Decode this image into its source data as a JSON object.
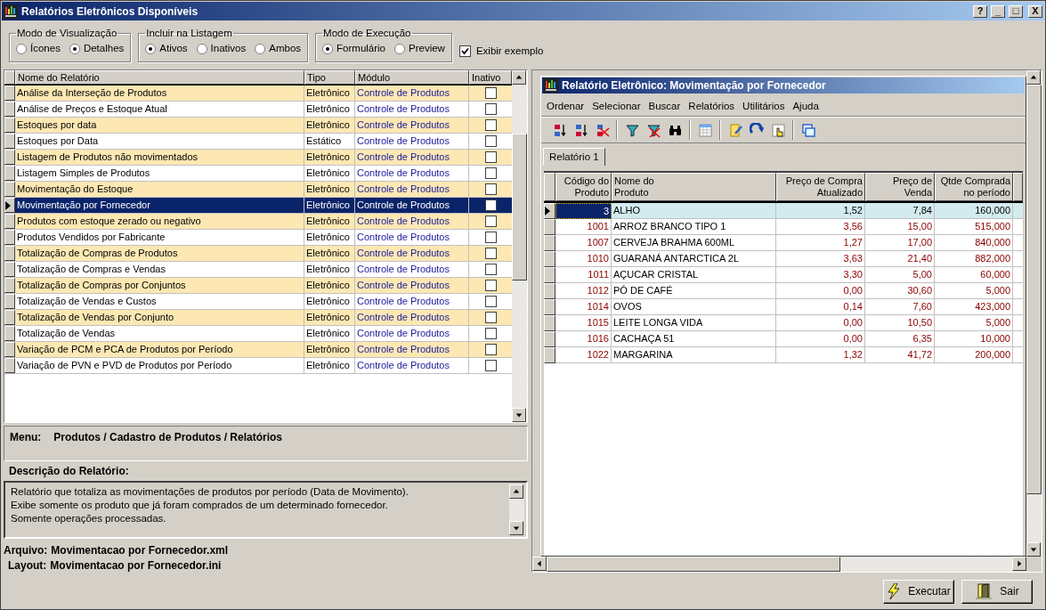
{
  "window": {
    "title": "Relatórios Eletrônicos Disponíveis",
    "title_buttons": [
      "?",
      "_",
      "□",
      "X"
    ]
  },
  "option_groups": [
    {
      "title": "Modo de Visualização",
      "options": [
        {
          "label": "Ícones",
          "selected": false
        },
        {
          "label": "Detalhes",
          "selected": true
        }
      ]
    },
    {
      "title": "Incluir na Listagem",
      "options": [
        {
          "label": "Ativos",
          "selected": true
        },
        {
          "label": "Inativos",
          "selected": false
        },
        {
          "label": "Ambos",
          "selected": false
        }
      ]
    },
    {
      "title": "Modo de Execução",
      "options": [
        {
          "label": "Formulário",
          "selected": true
        },
        {
          "label": "Preview",
          "selected": false
        }
      ]
    }
  ],
  "show_example": {
    "label": "Exibir exemplo",
    "checked": true
  },
  "reports_table": {
    "columns": [
      "Nome do Relatório",
      "Tipo",
      "Módulo",
      "Inativo"
    ],
    "rows": [
      {
        "name": "Análise da Interseção de Produtos",
        "type": "Eletrônico",
        "module": "Controle de Produtos",
        "inactive": false,
        "selected": false
      },
      {
        "name": "Análise de Preços e Estoque Atual",
        "type": "Eletrônico",
        "module": "Controle de Produtos",
        "inactive": false,
        "selected": false
      },
      {
        "name": "Estoques por data",
        "type": "Eletrônico",
        "module": "Controle de Produtos",
        "inactive": false,
        "selected": false
      },
      {
        "name": "Estoques por Data",
        "type": "Estático",
        "module": "Controle de Produtos",
        "inactive": false,
        "selected": false
      },
      {
        "name": "Listagem de Produtos não movimentados",
        "type": "Eletrônico",
        "module": "Controle de Produtos",
        "inactive": false,
        "selected": false
      },
      {
        "name": "Listagem Simples de Produtos",
        "type": "Eletrônico",
        "module": "Controle de Produtos",
        "inactive": false,
        "selected": false
      },
      {
        "name": "Movimentação do Estoque",
        "type": "Eletrônico",
        "module": "Controle de Produtos",
        "inactive": false,
        "selected": false
      },
      {
        "name": "Movimentação por Fornecedor",
        "type": "Eletrônico",
        "module": "Controle de Produtos",
        "inactive": false,
        "selected": true
      },
      {
        "name": "Produtos com estoque zerado ou negativo",
        "type": "Eletrônico",
        "module": "Controle de Produtos",
        "inactive": false,
        "selected": false
      },
      {
        "name": "Produtos Vendidos por Fabricante",
        "type": "Eletrônico",
        "module": "Controle de Produtos",
        "inactive": false,
        "selected": false
      },
      {
        "name": "Totalização de Compras de Produtos",
        "type": "Eletrônico",
        "module": "Controle de Produtos",
        "inactive": false,
        "selected": false
      },
      {
        "name": "Totalização de Compras e Vendas",
        "type": "Eletrônico",
        "module": "Controle de Produtos",
        "inactive": false,
        "selected": false
      },
      {
        "name": "Totalização de Compras por Conjuntos",
        "type": "Eletrônico",
        "module": "Controle de Produtos",
        "inactive": false,
        "selected": false
      },
      {
        "name": "Totalização de Vendas e Custos",
        "type": "Eletrônico",
        "module": "Controle de Produtos",
        "inactive": false,
        "selected": false
      },
      {
        "name": "Totalização de Vendas por Conjunto",
        "type": "Eletrônico",
        "module": "Controle de Produtos",
        "inactive": false,
        "selected": false
      },
      {
        "name": "Totalização de Vendas",
        "type": "Eletrônico",
        "module": "Controle de Produtos",
        "inactive": false,
        "selected": false
      },
      {
        "name": "Variação de PCM e PCA de Produtos por Período",
        "type": "Eletrônico",
        "module": "Controle de Produtos",
        "inactive": false,
        "selected": false
      },
      {
        "name": "Variação de PVN e PVD de Produtos por Período",
        "type": "Eletrônico",
        "module": "Controle de Produtos",
        "inactive": false,
        "selected": false
      }
    ]
  },
  "menu_path": {
    "label": "Menu:",
    "value": "Produtos / Cadastro de Produtos / Relatórios"
  },
  "description": {
    "label": "Descrição do Relatório:",
    "lines": [
      "Relatório que totaliza as movimentações de produtos por período (Data de Movimento).",
      "Exibe somente os produto que já foram comprados de um determinado fornecedor.",
      "Somente operações processadas."
    ]
  },
  "file_info": [
    {
      "label": "Arquivo:",
      "value": "Movimentacao por Fornecedor.xml"
    },
    {
      "label": "Layout:",
      "value": "Movimentacao por Fornecedor.ini"
    }
  ],
  "preview_window": {
    "title": "Relatório Eletrônico: Movimentação por Fornecedor",
    "menu": [
      "Ordenar",
      "Selecionar",
      "Buscar",
      "Relatórios",
      "Utilitários",
      "Ajuda"
    ],
    "toolbar": [
      {
        "kind": "sort-asc"
      },
      {
        "kind": "sort-desc"
      },
      {
        "kind": "sort-clear"
      },
      {
        "kind": "sep"
      },
      {
        "kind": "filter"
      },
      {
        "kind": "filter-clear"
      },
      {
        "kind": "find"
      },
      {
        "kind": "sep"
      },
      {
        "kind": "grid"
      },
      {
        "kind": "sep"
      },
      {
        "kind": "edit"
      },
      {
        "kind": "refresh"
      },
      {
        "kind": "hand"
      },
      {
        "kind": "sep"
      },
      {
        "kind": "windows"
      }
    ],
    "tabs": [
      {
        "label": "Relatório 1",
        "selected": true
      }
    ],
    "columns": [
      "Código do\nProduto",
      "Nome do\nProduto",
      "Preço de Compra\nAtualizado",
      "Preço de\nVenda",
      "Qtde Comprada\nno período"
    ],
    "rows": [
      {
        "code": "3",
        "name": "ALHO",
        "buy": "1,52",
        "sell": "7,84",
        "qty": "160,000",
        "selected": true
      },
      {
        "code": "1001",
        "name": "ARROZ BRANCO TIPO 1",
        "buy": "3,56",
        "sell": "15,00",
        "qty": "515,000",
        "selected": false
      },
      {
        "code": "1007",
        "name": "CERVEJA BRAHMA 600ML",
        "buy": "1,27",
        "sell": "17,00",
        "qty": "840,000",
        "selected": false
      },
      {
        "code": "1010",
        "name": "GUARANÁ ANTARCTICA 2L",
        "buy": "3,63",
        "sell": "21,40",
        "qty": "882,000",
        "selected": false
      },
      {
        "code": "1011",
        "name": "AÇUCAR CRISTAL",
        "buy": "3,30",
        "sell": "5,00",
        "qty": "60,000",
        "selected": false
      },
      {
        "code": "1012",
        "name": "PÓ DE CAFÉ",
        "buy": "0,00",
        "sell": "30,60",
        "qty": "5,000",
        "selected": false
      },
      {
        "code": "1014",
        "name": "OVOS",
        "buy": "0,14",
        "sell": "7,60",
        "qty": "423,000",
        "selected": false
      },
      {
        "code": "1015",
        "name": "LEITE LONGA VIDA",
        "buy": "0,00",
        "sell": "10,50",
        "qty": "5,000",
        "selected": false
      },
      {
        "code": "1016",
        "name": "CACHAÇA 51",
        "buy": "0,00",
        "sell": "6,35",
        "qty": "10,000",
        "selected": false
      },
      {
        "code": "1022",
        "name": "MARGARINA",
        "buy": "1,32",
        "sell": "41,72",
        "qty": "200,000",
        "selected": false
      }
    ]
  },
  "buttons": [
    {
      "kind": "run",
      "label": "Executar"
    },
    {
      "kind": "exit",
      "label": "Sair"
    }
  ]
}
